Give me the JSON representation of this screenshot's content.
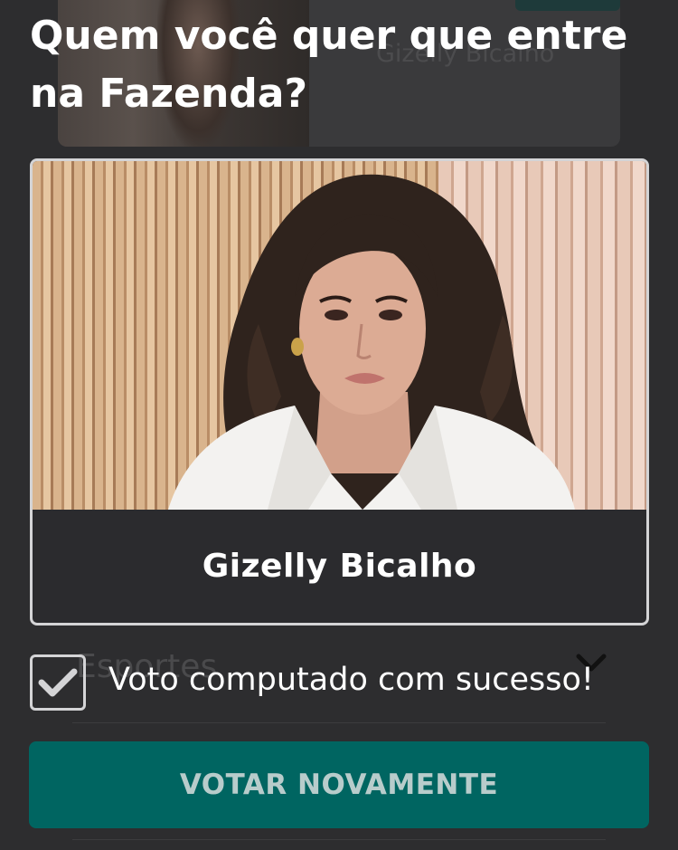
{
  "background": {
    "card_name": "Gizelly Bicalho",
    "row_label": "Esportes",
    "row_icon": "chevron-down-icon"
  },
  "modal": {
    "title": "Quem você quer que entre na Fazenda?",
    "candidate": {
      "name": "Gizelly Bicalho"
    },
    "status": {
      "icon": "checkmark-icon",
      "text": "Voto computado com sucesso!"
    },
    "vote_again_label": "VOTAR NOVAMENTE"
  },
  "colors": {
    "overlay": "#2d2d2f",
    "button": "#006561",
    "button_text": "#b8cccb",
    "text": "#ffffff",
    "border": "#d4d4d6"
  }
}
